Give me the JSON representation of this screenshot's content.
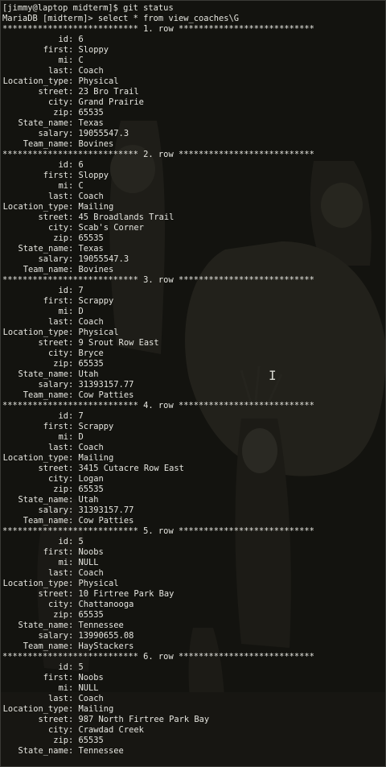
{
  "colors": {
    "background": "#141410",
    "text": "#e6e6e0"
  },
  "prompt_lines": [
    "[jimmy@laptop midterm]$ git status",
    "MariaDB [midterm]> select * from view_coaches\\G"
  ],
  "rows": [
    {
      "separator": "*************************** 1. row ***************************",
      "fields": [
        {
          "key": "id",
          "value": "6"
        },
        {
          "key": "first",
          "value": "Sloppy"
        },
        {
          "key": "mi",
          "value": "C"
        },
        {
          "key": "last",
          "value": "Coach"
        },
        {
          "key": "Location_type",
          "value": "Physical"
        },
        {
          "key": "street",
          "value": "23 Bro Trail"
        },
        {
          "key": "city",
          "value": "Grand Prairie"
        },
        {
          "key": "zip",
          "value": "65535"
        },
        {
          "key": "State_name",
          "value": "Texas"
        },
        {
          "key": "salary",
          "value": "19055547.3"
        },
        {
          "key": "Team_name",
          "value": "Bovines"
        }
      ]
    },
    {
      "separator": "*************************** 2. row ***************************",
      "fields": [
        {
          "key": "id",
          "value": "6"
        },
        {
          "key": "first",
          "value": "Sloppy"
        },
        {
          "key": "mi",
          "value": "C"
        },
        {
          "key": "last",
          "value": "Coach"
        },
        {
          "key": "Location_type",
          "value": "Mailing"
        },
        {
          "key": "street",
          "value": "45 Broadlands Trail"
        },
        {
          "key": "city",
          "value": "Scab's Corner"
        },
        {
          "key": "zip",
          "value": "65535"
        },
        {
          "key": "State_name",
          "value": "Texas"
        },
        {
          "key": "salary",
          "value": "19055547.3"
        },
        {
          "key": "Team_name",
          "value": "Bovines"
        }
      ]
    },
    {
      "separator": "*************************** 3. row ***************************",
      "fields": [
        {
          "key": "id",
          "value": "7"
        },
        {
          "key": "first",
          "value": "Scrappy"
        },
        {
          "key": "mi",
          "value": "D"
        },
        {
          "key": "last",
          "value": "Coach"
        },
        {
          "key": "Location_type",
          "value": "Physical"
        },
        {
          "key": "street",
          "value": "9 Srout Row East"
        },
        {
          "key": "city",
          "value": "Bryce"
        },
        {
          "key": "zip",
          "value": "65535"
        },
        {
          "key": "State_name",
          "value": "Utah"
        },
        {
          "key": "salary",
          "value": "31393157.77"
        },
        {
          "key": "Team_name",
          "value": "Cow Patties"
        }
      ]
    },
    {
      "separator": "*************************** 4. row ***************************",
      "fields": [
        {
          "key": "id",
          "value": "7"
        },
        {
          "key": "first",
          "value": "Scrappy"
        },
        {
          "key": "mi",
          "value": "D"
        },
        {
          "key": "last",
          "value": "Coach"
        },
        {
          "key": "Location_type",
          "value": "Mailing"
        },
        {
          "key": "street",
          "value": "3415 Cutacre Row East"
        },
        {
          "key": "city",
          "value": "Logan"
        },
        {
          "key": "zip",
          "value": "65535"
        },
        {
          "key": "State_name",
          "value": "Utah"
        },
        {
          "key": "salary",
          "value": "31393157.77"
        },
        {
          "key": "Team_name",
          "value": "Cow Patties"
        }
      ]
    },
    {
      "separator": "*************************** 5. row ***************************",
      "fields": [
        {
          "key": "id",
          "value": "5"
        },
        {
          "key": "first",
          "value": "Noobs"
        },
        {
          "key": "mi",
          "value": "NULL"
        },
        {
          "key": "last",
          "value": "Coach"
        },
        {
          "key": "Location_type",
          "value": "Physical"
        },
        {
          "key": "street",
          "value": "10 Firtree Park Bay"
        },
        {
          "key": "city",
          "value": "Chattanooga"
        },
        {
          "key": "zip",
          "value": "65535"
        },
        {
          "key": "State_name",
          "value": "Tennessee"
        },
        {
          "key": "salary",
          "value": "13990655.08"
        },
        {
          "key": "Team_name",
          "value": "HayStackers"
        }
      ]
    },
    {
      "separator": "*************************** 6. row ***************************",
      "fields": [
        {
          "key": "id",
          "value": "5"
        },
        {
          "key": "first",
          "value": "Noobs"
        },
        {
          "key": "mi",
          "value": "NULL"
        },
        {
          "key": "last",
          "value": "Coach"
        },
        {
          "key": "Location_type",
          "value": "Mailing"
        },
        {
          "key": "street",
          "value": "987 North Firtree Park Bay"
        },
        {
          "key": "city",
          "value": "Crawdad Creek"
        },
        {
          "key": "zip",
          "value": "65535"
        },
        {
          "key": "State_name",
          "value": "Tennessee"
        }
      ]
    }
  ],
  "cursor": {
    "icon": "text-cursor-icon",
    "glyph": "I"
  }
}
